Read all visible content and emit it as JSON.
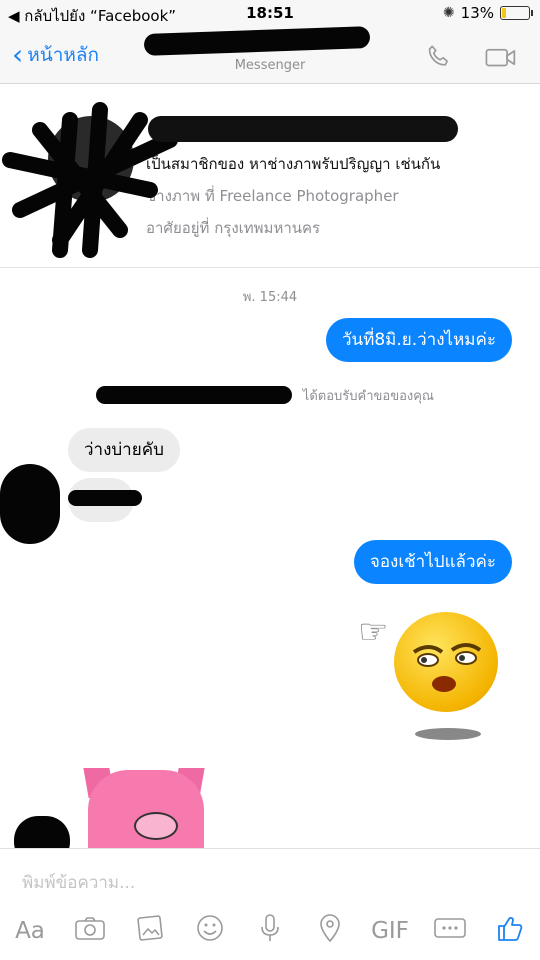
{
  "status_bar": {
    "back_label": "◀ กลับไปยัง “Facebook”",
    "time": "18:51",
    "battery": "13%"
  },
  "nav": {
    "back_label": "หน้าหลัก",
    "contact_name": "",
    "subtitle": "Messenger"
  },
  "profile": {
    "name": "",
    "line1": "เป็นสมาชิกของ หาช่างภาพรับปริญญา เช่นกัน",
    "line2": "ช่างภาพ ที่ Freelance Photographer",
    "line3": "อาศัยอยู่ที่ กรุงเทพมหานคร"
  },
  "chat": {
    "timestamp": "พ. 15:44",
    "msg1": "วันที่8มิ.ย.ว่างไหมค่ะ",
    "notice": "ได้ตอบรับคำขอของคุณ",
    "msg2": "ว่างบ่ายคับ",
    "msg3": "",
    "msg4": "จองเช้าไปแล้วค่ะ"
  },
  "composer": {
    "placeholder": "พิมพ์ข้อความ...",
    "aa_label": "Aa",
    "gif_label": "GIF"
  },
  "colors": {
    "accent": "#1d82f3",
    "outgoing_bubble": "#0b84ff",
    "incoming_bubble": "#ececec"
  }
}
